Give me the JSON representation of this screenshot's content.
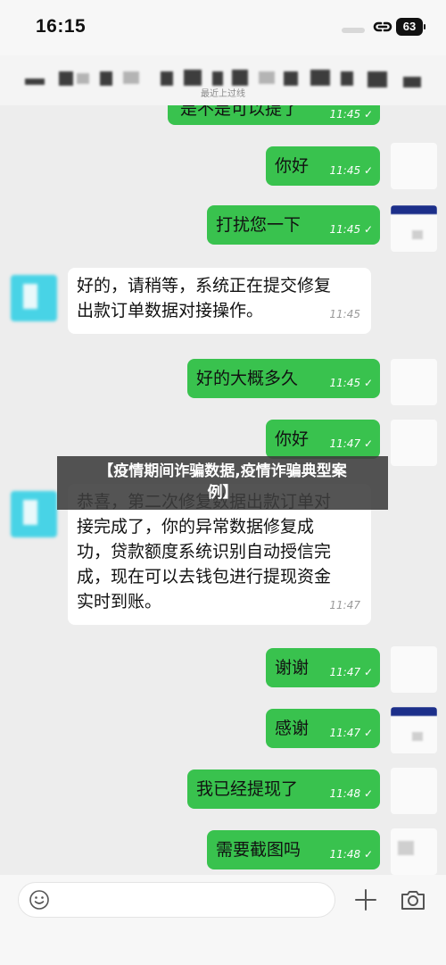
{
  "status": {
    "time": "16:15",
    "battery": "63"
  },
  "header": {
    "subtitle": "最近上过线"
  },
  "messages": [
    {
      "dir": "out",
      "text": "是不是可以提了",
      "time": "11:45"
    },
    {
      "dir": "out",
      "text": "你好",
      "time": "11:45"
    },
    {
      "dir": "out",
      "text": "打扰您一下",
      "time": "11:45"
    },
    {
      "dir": "in",
      "lines": [
        "好的，请稍等，系统正在提交修复",
        "出款订单数据对接操作。"
      ],
      "time": "11:45"
    },
    {
      "dir": "out",
      "text": "好的大概多久",
      "time": "11:45"
    },
    {
      "dir": "out",
      "text": "你好",
      "time": "11:47"
    },
    {
      "dir": "in",
      "lines": [
        "恭喜，第二次修复数据出款订单对",
        "接完成了，你的异常数据修复成",
        "功，贷款额度系统识别自动授信完",
        "成，现在可以去钱包进行提现资金",
        "实时到账。"
      ],
      "time": "11:47"
    },
    {
      "dir": "out",
      "text": "谢谢",
      "time": "11:47"
    },
    {
      "dir": "out",
      "text": "感谢",
      "time": "11:47"
    },
    {
      "dir": "out",
      "text": "我已经提现了",
      "time": "11:48"
    },
    {
      "dir": "out",
      "text": "需要截图吗",
      "time": "11:48"
    }
  ],
  "banner": {
    "line1": "【疫情期间诈骗数据,疫情诈骗典型案",
    "line2": "例】"
  },
  "colors": {
    "outgoing": "#39c24e",
    "incoming": "#ffffff",
    "chat_bg": "#ededed"
  },
  "icons": [
    "link-icon",
    "battery-icon",
    "emoji-icon",
    "plus-icon",
    "camera-icon",
    "read-check-icon"
  ]
}
